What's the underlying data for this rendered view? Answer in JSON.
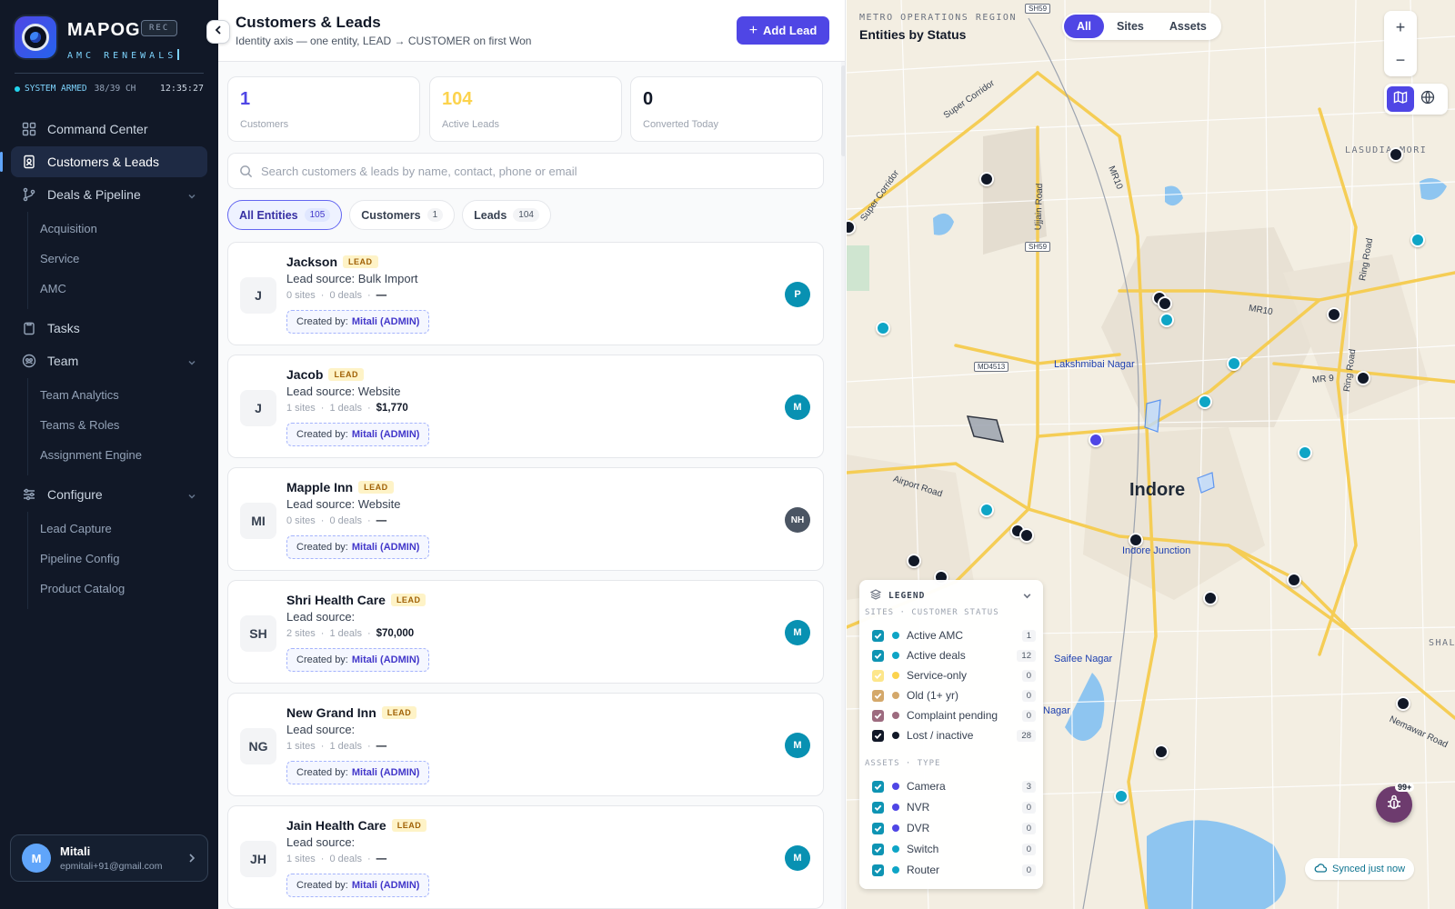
{
  "brand": {
    "title": "MAPOG",
    "rec": "REC",
    "subtitle": "AMC RENEWALS"
  },
  "system": {
    "status": "SYSTEM ARMED",
    "channels": "38/39 CH",
    "clock": "12:35:27"
  },
  "nav": {
    "command_center": "Command Center",
    "customers_leads": "Customers & Leads",
    "deals_pipeline": "Deals & Pipeline",
    "deals_sub": [
      "Acquisition",
      "Service",
      "AMC"
    ],
    "tasks": "Tasks",
    "team": "Team",
    "team_sub": [
      "Team Analytics",
      "Teams & Roles",
      "Assignment Engine"
    ],
    "configure": "Configure",
    "configure_sub": [
      "Lead Capture",
      "Pipeline Config",
      "Product Catalog"
    ]
  },
  "user": {
    "initial": "M",
    "name": "Mitali",
    "email": "epmitali+91@gmail.com"
  },
  "header": {
    "title": "Customers & Leads",
    "subtitle": "Identity axis — one entity, LEAD → CUSTOMER on first Won",
    "add_label": "Add Lead"
  },
  "stats": [
    {
      "value": "1",
      "label": "Customers",
      "color": "#4f46e5"
    },
    {
      "value": "104",
      "label": "Active Leads",
      "color": "#fcd34d"
    },
    {
      "value": "0",
      "label": "Converted Today",
      "color": "#111827"
    }
  ],
  "search": {
    "placeholder": "Search customers & leads by name, contact, phone or email"
  },
  "filters": [
    {
      "label": "All Entities",
      "count": "105"
    },
    {
      "label": "Customers",
      "count": "1"
    },
    {
      "label": "Leads",
      "count": "104"
    }
  ],
  "entities": [
    {
      "initials": "J",
      "name": "Jackson",
      "badge": "LEAD",
      "source": "Lead source: Bulk Import",
      "sites": "0 sites",
      "deals": "0 deals",
      "amount": "—",
      "created_label": "Created by:",
      "created_by": "Mitali (ADMIN)",
      "owner": "P"
    },
    {
      "initials": "J",
      "name": "Jacob",
      "badge": "LEAD",
      "source": "Lead source: Website",
      "sites": "1 sites",
      "deals": "1 deals",
      "amount": "$1,770",
      "created_label": "Created by:",
      "created_by": "Mitali (ADMIN)",
      "owner": "M"
    },
    {
      "initials": "MI",
      "name": "Mapple Inn",
      "badge": "LEAD",
      "source": "Lead source: Website",
      "sites": "0 sites",
      "deals": "0 deals",
      "amount": "—",
      "created_label": "Created by:",
      "created_by": "Mitali (ADMIN)",
      "owner": "NH"
    },
    {
      "initials": "SH",
      "name": "Shri Health Care",
      "badge": "LEAD",
      "source": "Lead source:",
      "sites": "2 sites",
      "deals": "1 deals",
      "amount": "$70,000",
      "created_label": "Created by:",
      "created_by": "Mitali (ADMIN)",
      "owner": "M"
    },
    {
      "initials": "NG",
      "name": "New Grand Inn",
      "badge": "LEAD",
      "source": "Lead source:",
      "sites": "1 sites",
      "deals": "1 deals",
      "amount": "—",
      "created_label": "Created by:",
      "created_by": "Mitali (ADMIN)",
      "owner": "M"
    },
    {
      "initials": "JH",
      "name": "Jain Health Care",
      "badge": "LEAD",
      "source": "Lead source:",
      "sites": "1 sites",
      "deals": "0 deals",
      "amount": "—",
      "created_label": "Created by:",
      "created_by": "Mitali (ADMIN)",
      "owner": "M"
    }
  ],
  "map": {
    "region": "METRO OPERATIONS REGION",
    "title": "Entities by Status",
    "tabs": [
      "All",
      "Sites",
      "Assets"
    ],
    "zoom_in": "+",
    "zoom_out": "−",
    "city": "Indore",
    "places": [
      "Lakshmibai Nagar",
      "Indore Junction",
      "Saifee Nagar",
      "Nagar"
    ],
    "roads": [
      "Super Corridor",
      "Super Corridor",
      "MR10",
      "Ujjain Road",
      "Airport Road",
      "Ring Road",
      "Ring Road",
      "MR10",
      "MR 9",
      "Nemawar Road"
    ],
    "shields": [
      "SH59",
      "SH59",
      "MD4513"
    ],
    "edge_labels": [
      "LASUDIA MORI",
      "SHAL"
    ],
    "synced": "Synced just now",
    "bug_badge": "99+"
  },
  "legend": {
    "title": "LEGEND",
    "sites_section": "SITES · CUSTOMER STATUS",
    "sites": [
      {
        "label": "Active AMC",
        "count": "1",
        "color": "#0ea5c6"
      },
      {
        "label": "Active deals",
        "count": "12",
        "color": "#0ea5c6"
      },
      {
        "label": "Service-only",
        "count": "0",
        "color": "#fcd34d"
      },
      {
        "label": "Old (1+ yr)",
        "count": "0",
        "color": "#d4a86a"
      },
      {
        "label": "Complaint pending",
        "count": "0",
        "color": "#9d6b7f"
      },
      {
        "label": "Lost / inactive",
        "count": "28",
        "color": "#111827"
      }
    ],
    "assets_section": "ASSETS · TYPE",
    "assets": [
      {
        "label": "Camera",
        "count": "3",
        "color": "#4f46e5"
      },
      {
        "label": "NVR",
        "count": "0",
        "color": "#4f46e5"
      },
      {
        "label": "DVR",
        "count": "0",
        "color": "#4f46e5"
      },
      {
        "label": "Switch",
        "count": "0",
        "color": "#0ea5c6"
      },
      {
        "label": "Router",
        "count": "0",
        "color": "#0ea5c6"
      }
    ]
  }
}
